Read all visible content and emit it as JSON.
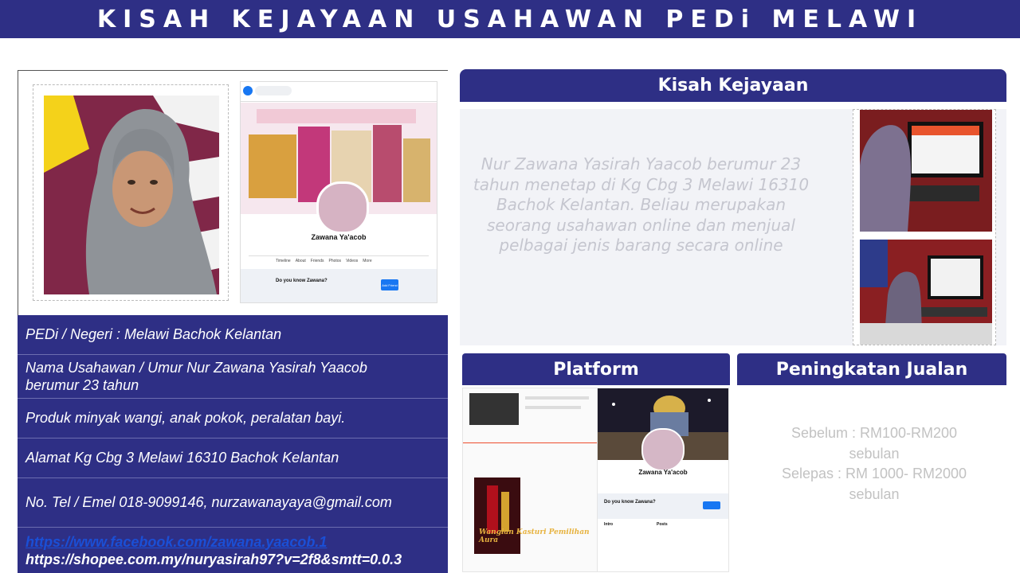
{
  "banner": {
    "title": "KISAH KEJAYAAN USAHAWAN PEDi MELAWI"
  },
  "photos": {
    "profile_name": "Zawana Ya'acob",
    "profile_tabs": [
      "Timeline",
      "About",
      "Friends",
      "Photos",
      "Videos",
      "More"
    ],
    "fb_prompt": "Do you know Zawana?",
    "add_friend": "Add Friend"
  },
  "info": {
    "pedi": "PEDi / Negeri : Melawi Bachok Kelantan",
    "nama_line1": "Nama Usahawan / Umur Nur Zawana Yasirah Yaacob",
    "nama_line2": "berumur 23 tahun",
    "produk": "Produk  minyak wangi, anak pokok, peralatan bayi.",
    "alamat": "Alamat Kg Cbg 3 Melawi 16310 Bachok Kelantan",
    "contact": "No. Tel / Emel 018-9099146, nurzawanayaya@gmail.com",
    "facebook_url": "https://www.facebook.com/zawana.yaacob.1",
    "shopee_url": "https://shopee.com.my/nuryasirah97?v=2f8&smtt=0.0.3"
  },
  "kisah": {
    "heading": "Kisah Kejayaan",
    "lines": [
      "Nur Zawana Yasirah Yaacob berumur 23",
      "tahun menetap di Kg Cbg 3 Melawi 16310",
      "Bachok Kelantan. Beliau merupakan",
      "seorang usahawan online dan menjual",
      "pelbagai jenis barang secara online"
    ]
  },
  "platform": {
    "heading": "Platform",
    "shop_name": "Wangian Kasturi Pemilihan Aura",
    "fb_name": "Zawana Ya'acob",
    "fb_prompt": "Do you know Zawana?",
    "intro": "Intro",
    "posts": "Posts"
  },
  "jualan": {
    "heading": "Peningkatan Jualan",
    "lines": [
      "Sebelum : RM100-RM200",
      "sebulan",
      "Selepas : RM 1000- RM2000",
      "sebulan"
    ]
  },
  "colors": {
    "navy": "#2e2f85",
    "light_panel": "#f2f3f7",
    "muted_text": "#c5c6cf",
    "link": "#1a4fd6"
  }
}
